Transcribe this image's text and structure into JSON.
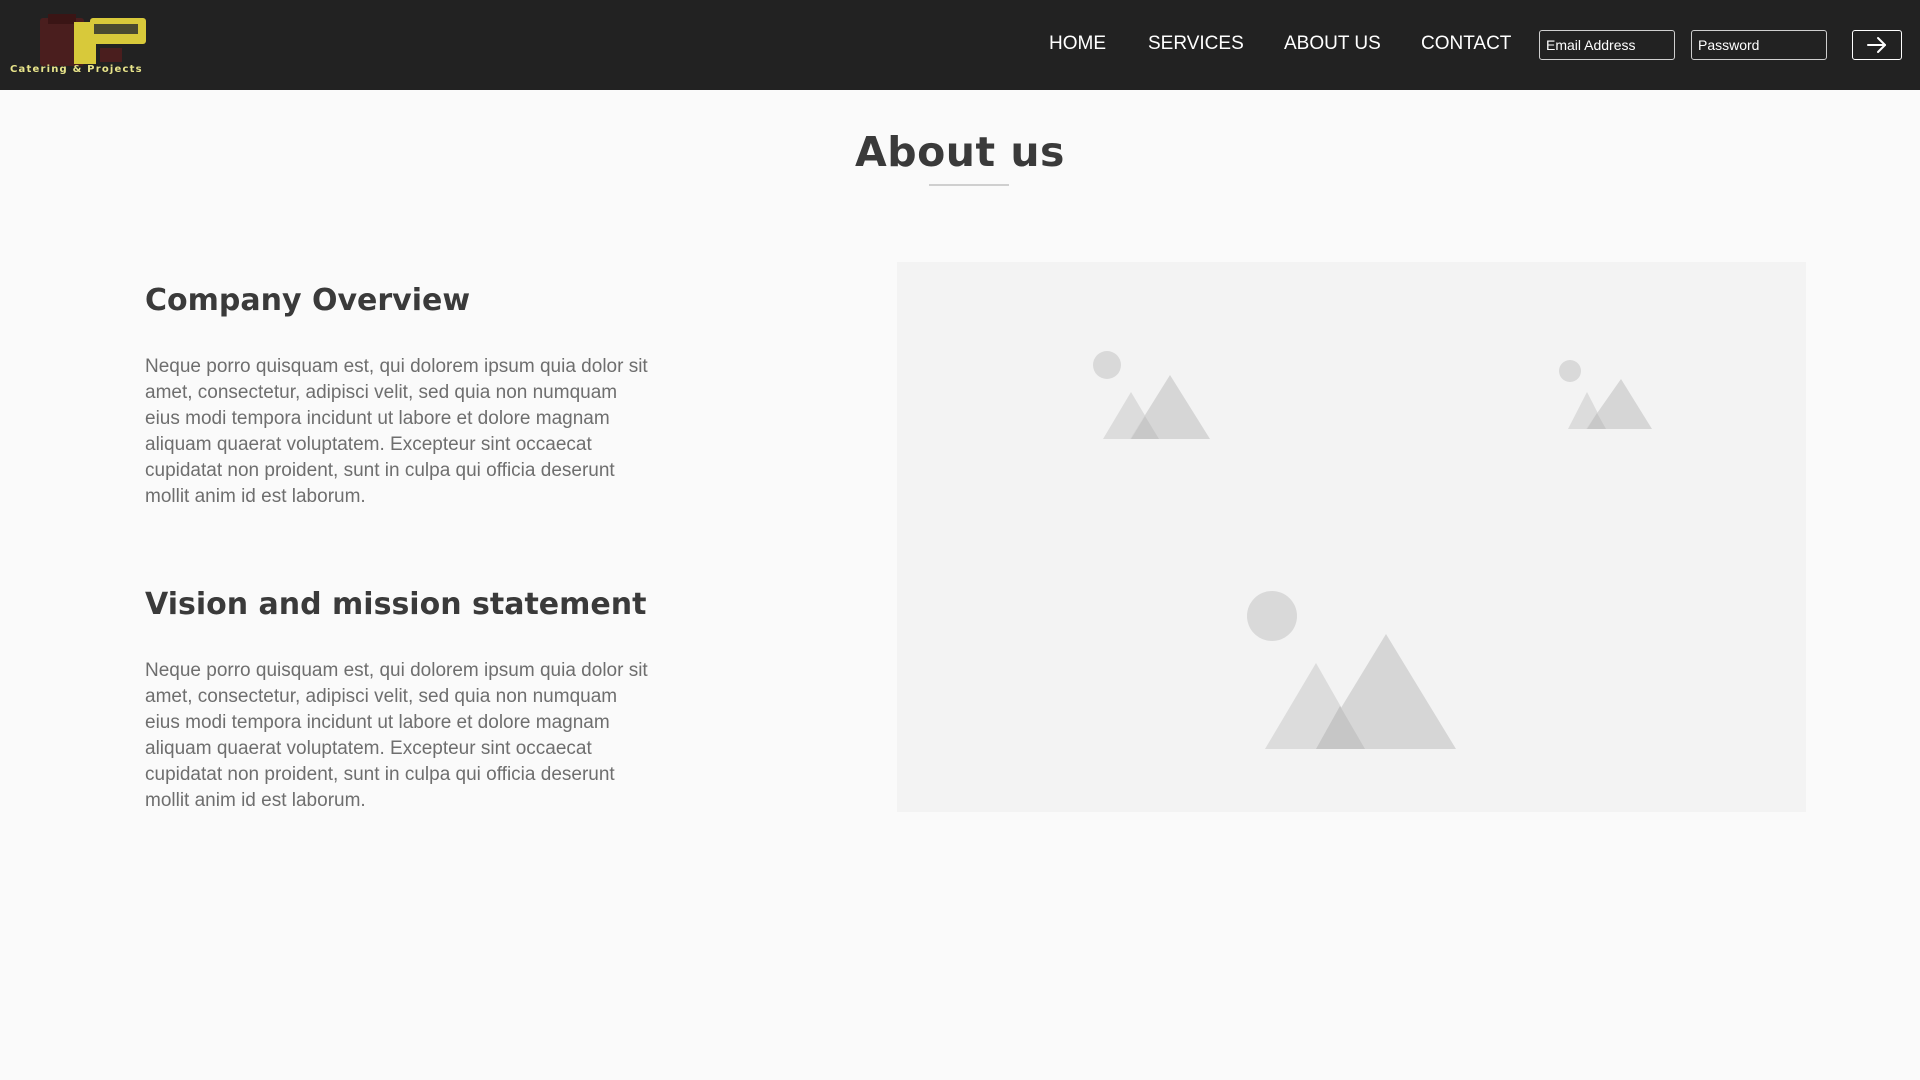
{
  "header": {
    "logo": {
      "caption": "Catering & Projects",
      "brand_colors": {
        "mark_dark": "#4a1e1e",
        "mark_yellow": "#d8c93a"
      }
    },
    "nav": [
      {
        "label": "HOME"
      },
      {
        "label": "SERVICES"
      },
      {
        "label": "ABOUT US"
      },
      {
        "label": "CONTACT"
      }
    ],
    "login": {
      "email_placeholder": "Email Address",
      "password_placeholder": "Password",
      "submit_icon": "arrow-right-icon"
    }
  },
  "main": {
    "title": "About us",
    "sections": [
      {
        "heading": "Company Overview",
        "body": "Neque porro quisquam est, qui dolorem ipsum quia dolor sit amet, consectetur, adipisci velit, sed quia non numquam eius modi tempora incidunt ut labore et dolore magnam aliquam quaerat voluptatem. Excepteur sint occaecat cupidatat non proident, sunt in culpa qui officia deserunt mollit anim id est laborum."
      },
      {
        "heading": "Vision and mission statement",
        "body": "Neque porro quisquam est, qui dolorem ipsum quia dolor sit amet, consectetur, adipisci velit, sed quia non numquam eius modi tempora incidunt ut labore et dolore magnam aliquam quaerat voluptatem. Excepteur sint occaecat cupidatat non proident, sunt in culpa qui officia deserunt mollit anim id est laborum."
      }
    ],
    "image_placeholder": {
      "icon": "image-placeholder-icon"
    }
  },
  "colors": {
    "header_bg": "#222222",
    "page_bg": "#fafafa",
    "heading_text": "#3a3a3a",
    "body_text": "#6e6e6e",
    "placeholder_bg": "#f3f3f3",
    "placeholder_shape": "#d9d9d9"
  }
}
